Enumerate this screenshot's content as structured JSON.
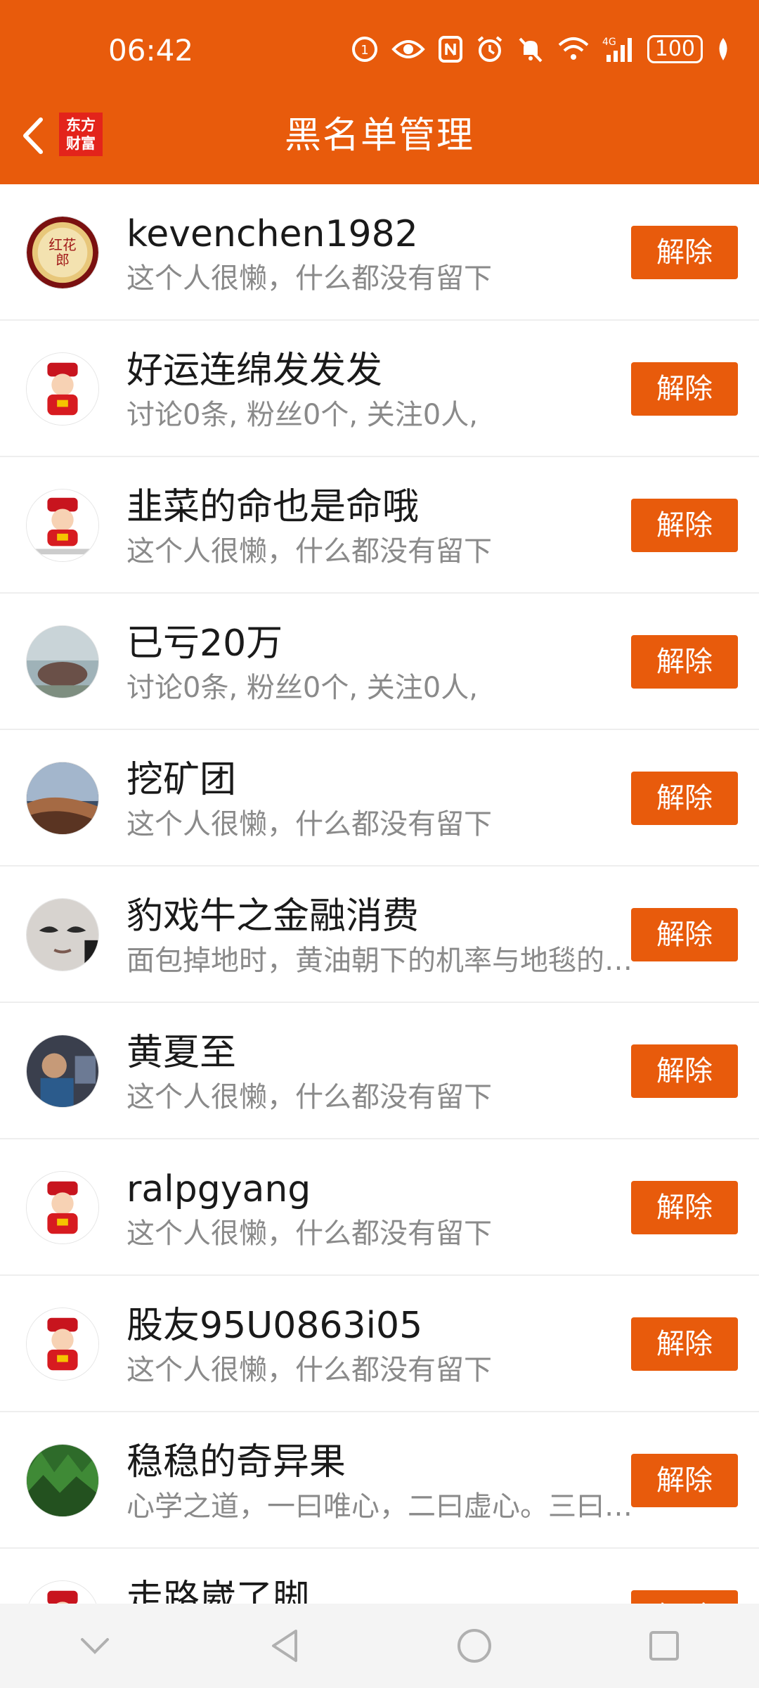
{
  "status_bar": {
    "time": "06:42",
    "battery": "100",
    "network": "4G"
  },
  "header": {
    "title": "黑名单管理",
    "logo_text_line1": "东方",
    "logo_text_line2": "财富",
    "accent_color": "#e85b0c"
  },
  "list": {
    "remove_label": "解除",
    "items": [
      {
        "name": "kevenchen1982",
        "desc": "这个人很懒，什么都没有留下",
        "avatar_icon": "gold-seal-avatar"
      },
      {
        "name": "好运连绵发发发",
        "desc": "讨论0条, 粉丝0个, 关注0人,",
        "avatar_icon": "caishen-avatar"
      },
      {
        "name": "韭菜的命也是命哦",
        "desc": "这个人很懒，什么都没有留下",
        "avatar_icon": "caishen-avatar"
      },
      {
        "name": "已亏20万",
        "desc": "讨论0条, 粉丝0个, 关注0人,",
        "avatar_icon": "photo-avatar"
      },
      {
        "name": "挖矿团",
        "desc": "这个人很懒，什么都没有留下",
        "avatar_icon": "desert-avatar"
      },
      {
        "name": "豹戏牛之金融消费",
        "desc": "面包掉地时，黄油朝下的机率与地毯的价格成正比",
        "avatar_icon": "face-avatar"
      },
      {
        "name": "黄夏至",
        "desc": "这个人很懒，什么都没有留下",
        "avatar_icon": "photo-avatar"
      },
      {
        "name": "ralpgyang",
        "desc": "这个人很懒，什么都没有留下",
        "avatar_icon": "caishen-avatar"
      },
      {
        "name": "股友95U0863i05",
        "desc": "这个人很懒，什么都没有留下",
        "avatar_icon": "caishen-avatar"
      },
      {
        "name": "稳稳的奇异果",
        "desc": "心学之道，一曰唯心，二曰虚心。三曰……",
        "avatar_icon": "forest-avatar"
      },
      {
        "name": "走路崴了脚",
        "desc": "",
        "avatar_icon": "caishen-avatar"
      }
    ]
  },
  "nav_bar": {
    "icons": [
      "chevron-down-icon",
      "back-triangle-icon",
      "home-circle-icon",
      "recents-square-icon"
    ]
  }
}
